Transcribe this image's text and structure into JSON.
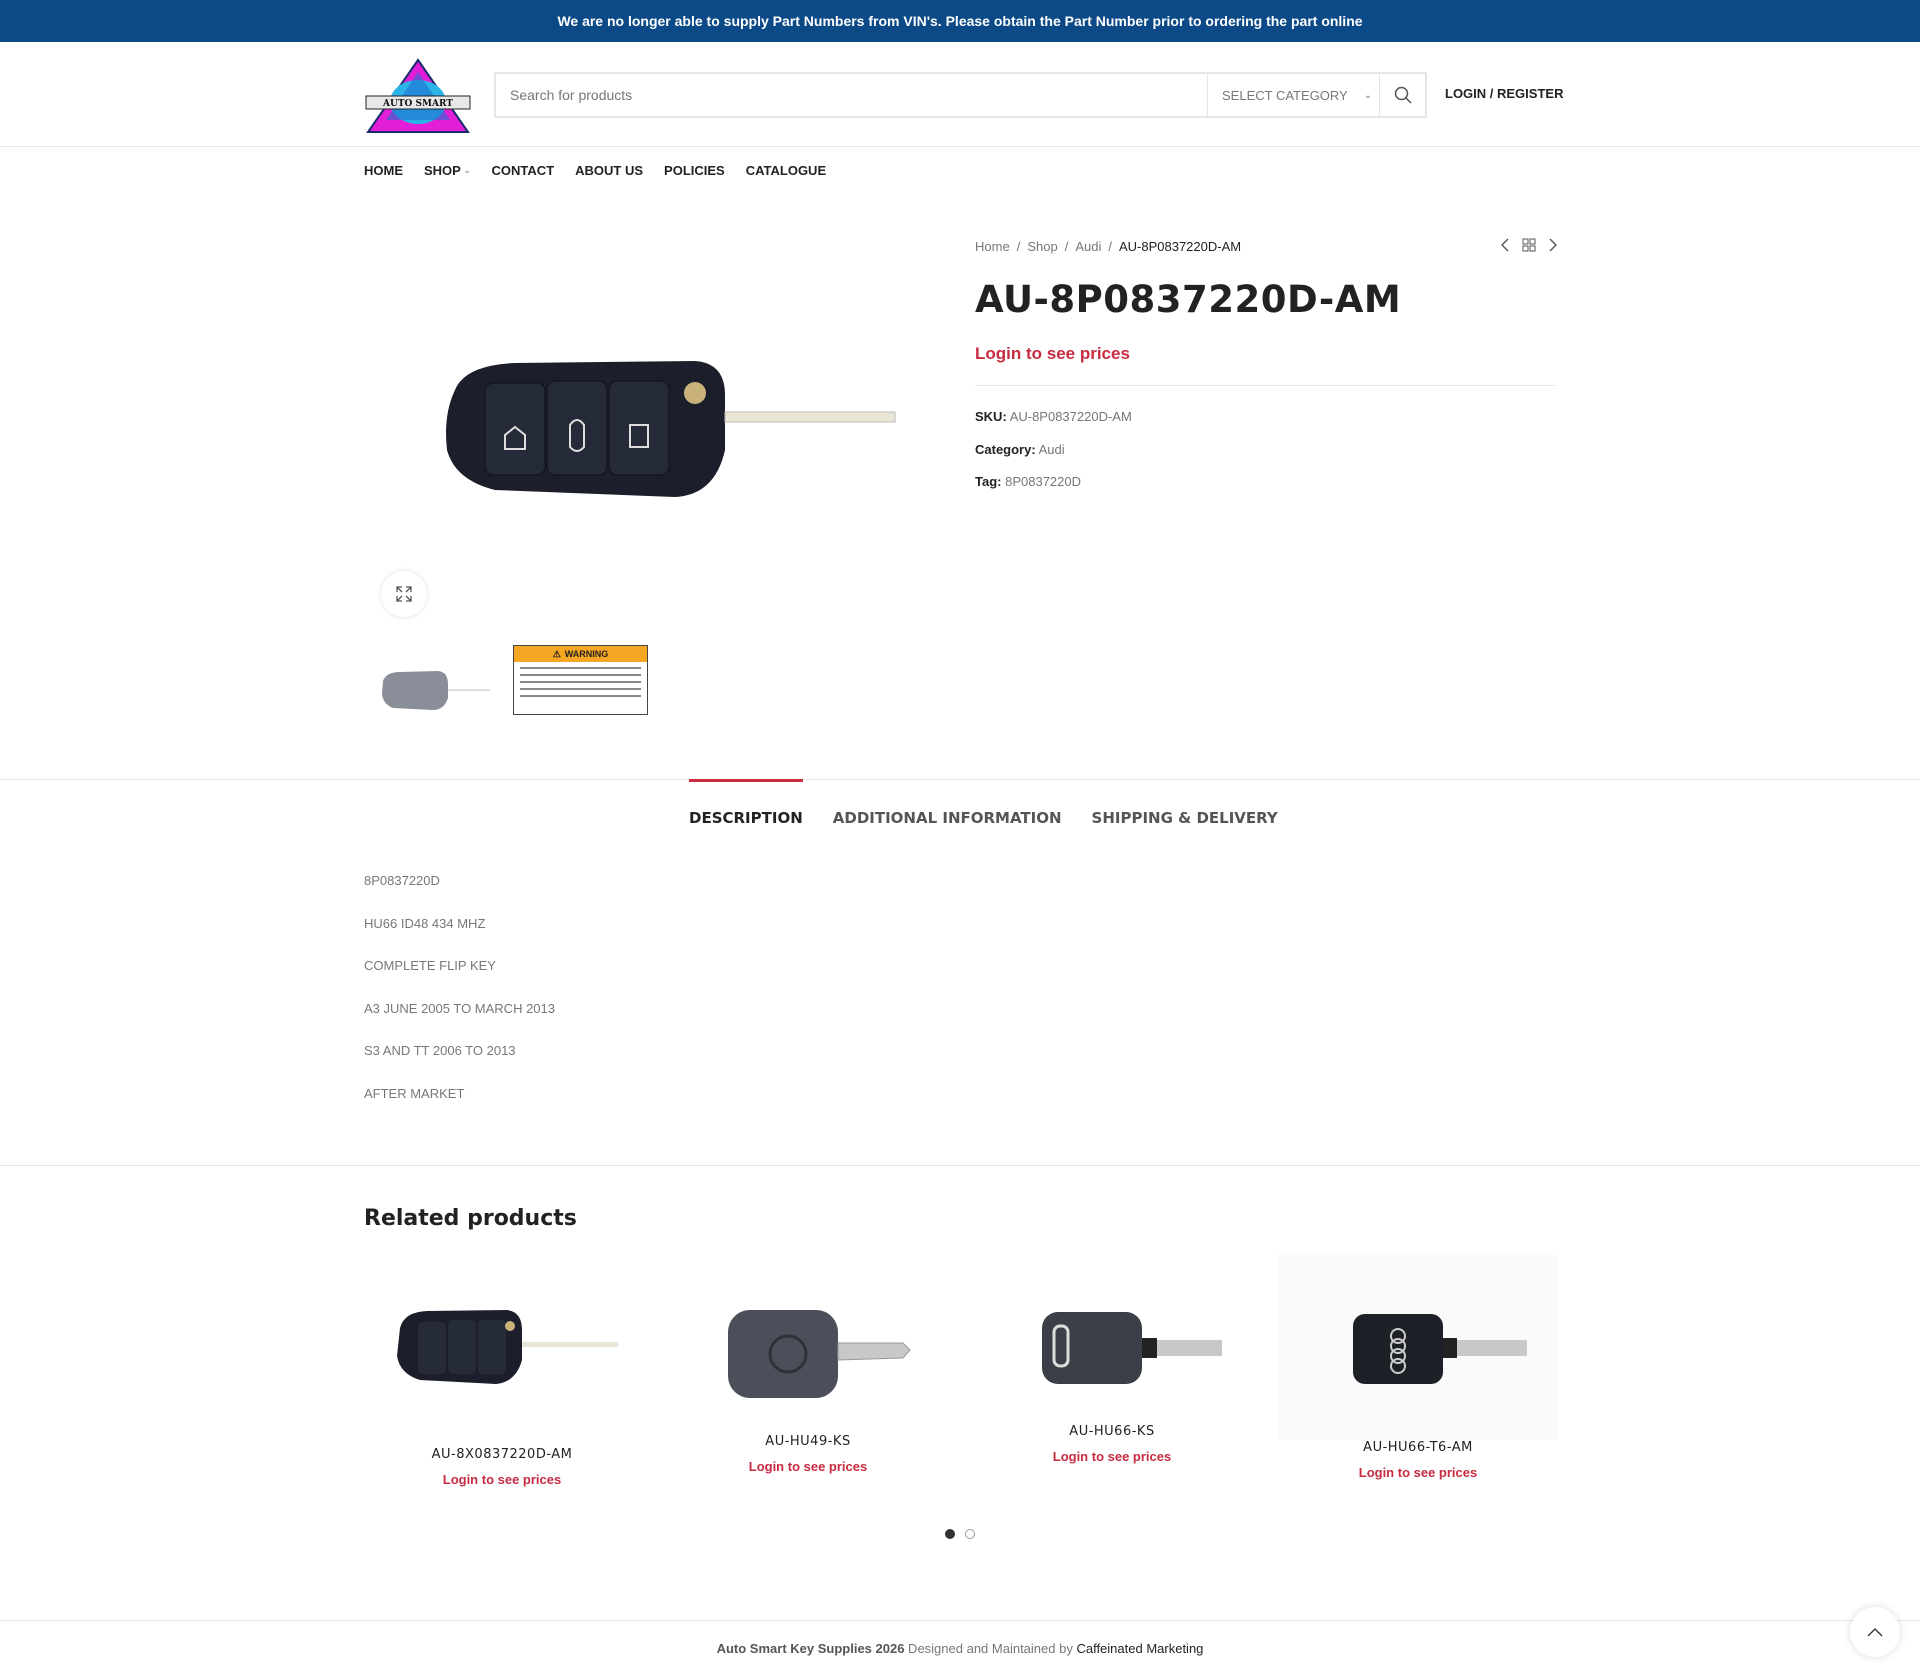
{
  "topbar": {
    "notice": "We are no longer able to supply Part Numbers from VIN's. Please obtain the Part Number prior to ordering the part online"
  },
  "header": {
    "logo_text": "AUTO SMART",
    "search_placeholder": "Search for products",
    "category_label": "SELECT CATEGORY",
    "login_label": "LOGIN / REGISTER"
  },
  "nav": {
    "items": [
      "HOME",
      "SHOP",
      "CONTACT",
      "ABOUT US",
      "POLICIES",
      "CATALOGUE"
    ]
  },
  "breadcrumb": {
    "home": "Home",
    "shop": "Shop",
    "category": "Audi",
    "current": "AU-8P0837220D-AM",
    "sep": "/"
  },
  "product": {
    "title": "AU-8P0837220D-AM",
    "price_text": "Login to see prices",
    "sku_label": "SKU:",
    "sku": "AU-8P0837220D-AM",
    "category_label": "Category:",
    "category": "Audi",
    "tag_label": "Tag:",
    "tag": "8P0837220D",
    "thumb_warning": "WARNING"
  },
  "tabs": [
    "DESCRIPTION",
    "ADDITIONAL INFORMATION",
    "SHIPPING & DELIVERY"
  ],
  "description": [
    "8P0837220D",
    "HU66  ID48  434 MHZ",
    "COMPLETE FLIP KEY",
    "A3 JUNE 2005 TO MARCH 2013",
    "S3 AND TT  2006 TO 2013",
    "AFTER MARKET"
  ],
  "related": {
    "title": "Related products",
    "items": [
      {
        "name": "AU-8X0837220D-AM",
        "price": "Login to see prices"
      },
      {
        "name": "AU-HU49-KS",
        "price": "Login to see prices"
      },
      {
        "name": "AU-HU66-KS",
        "price": "Login to see prices"
      },
      {
        "name": "AU-HU66-T6-AM",
        "price": "Login to see prices"
      }
    ]
  },
  "footer": {
    "brand": "Auto Smart Key Supplies 2026",
    "middle": " Designed and Maintained by ",
    "agency": "Caffeinated Marketing"
  },
  "colors": {
    "topbar": "#0b4a86",
    "price": "#c72c41"
  }
}
